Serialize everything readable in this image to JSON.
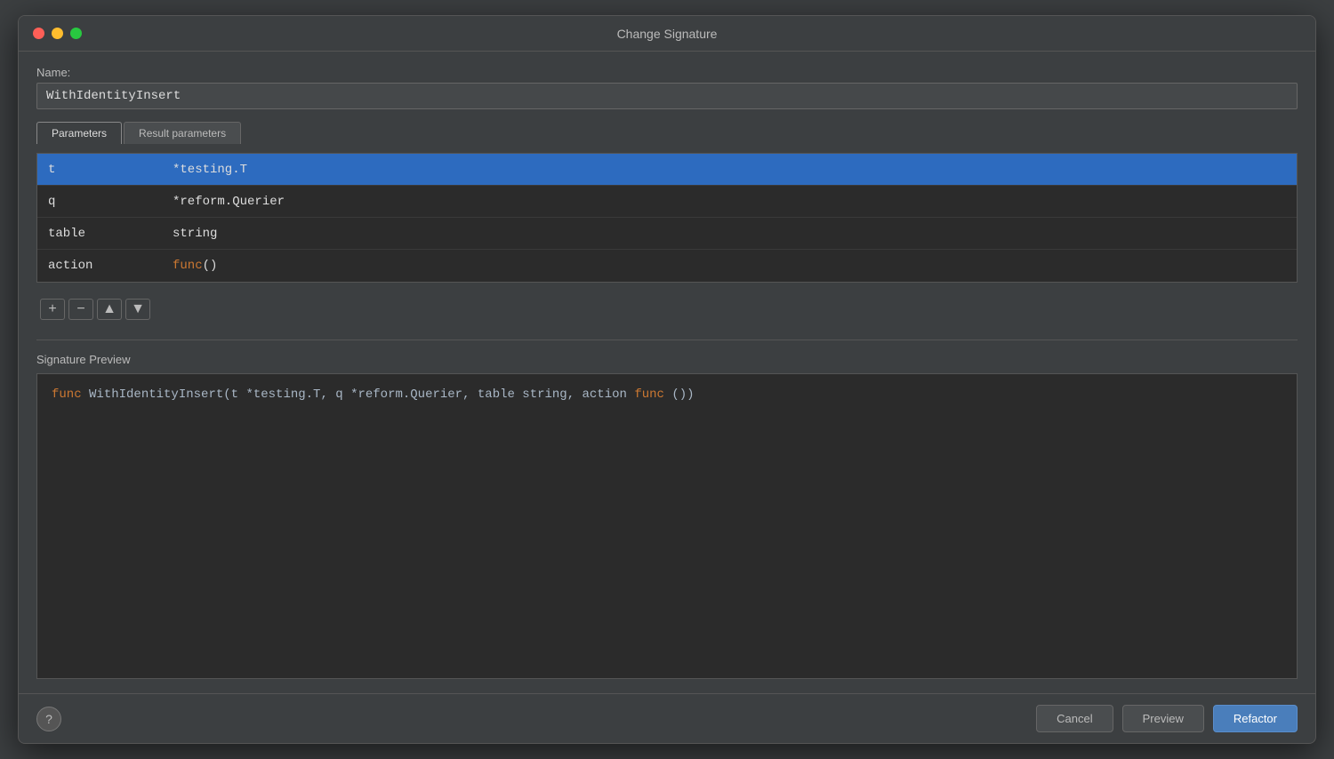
{
  "dialog": {
    "title": "Change Signature"
  },
  "window_controls": {
    "close_label": "close",
    "minimize_label": "minimize",
    "maximize_label": "maximize"
  },
  "name_field": {
    "label": "Name:",
    "value": "WithIdentityInsert"
  },
  "tabs": [
    {
      "id": "parameters",
      "label": "Parameters",
      "active": true
    },
    {
      "id": "result_parameters",
      "label": "Result parameters",
      "active": false
    }
  ],
  "params": [
    {
      "name": "t",
      "type": "*testing.T",
      "selected": true
    },
    {
      "name": "q",
      "type": "*reform.Querier",
      "selected": false
    },
    {
      "name": "table",
      "type": "string",
      "selected": false
    },
    {
      "name": "action",
      "type_keyword": "func",
      "type_suffix": "()",
      "selected": false
    }
  ],
  "toolbar": {
    "add_label": "+",
    "remove_label": "−",
    "up_label": "▲",
    "down_label": "▼"
  },
  "signature_preview": {
    "label": "Signature Preview",
    "text_keyword1": "func",
    "text_name": " WithIdentityInsert(t *testing.T, q *reform.Querier, table string, action ",
    "text_keyword2": "func",
    "text_suffix": "())"
  },
  "buttons": {
    "help_label": "?",
    "cancel_label": "Cancel",
    "preview_label": "Preview",
    "refactor_label": "Refactor"
  }
}
